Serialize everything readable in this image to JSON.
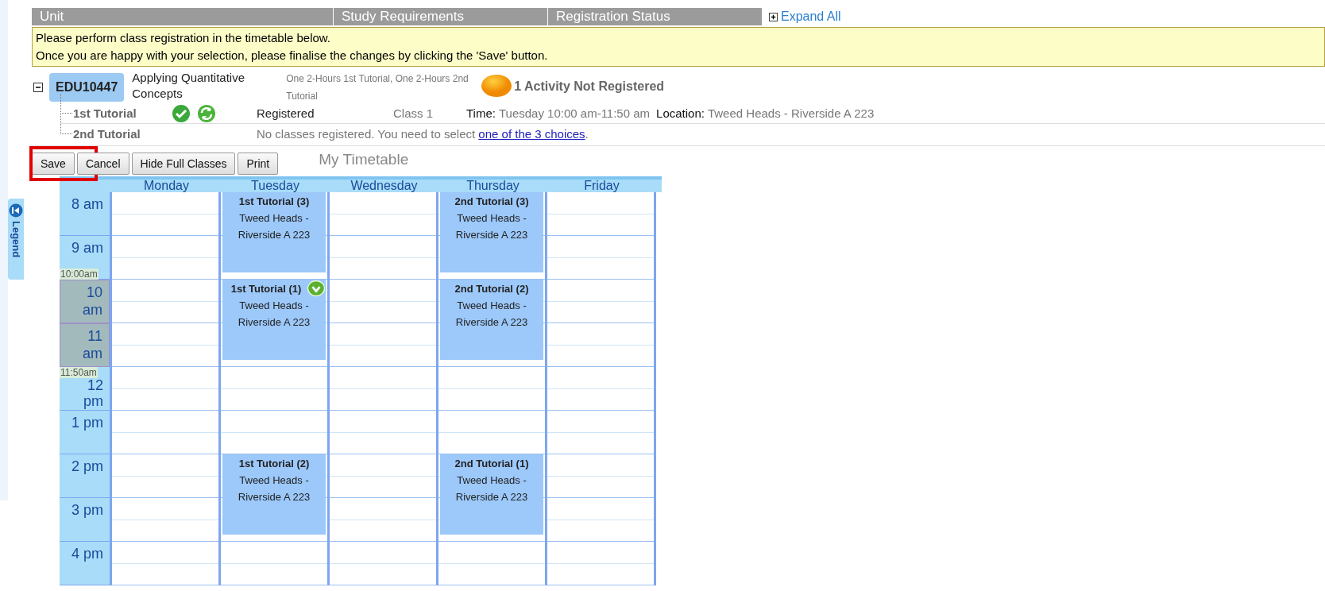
{
  "header": {
    "columns": [
      "Unit",
      "Study Requirements",
      "Registration Status"
    ],
    "expand_all": "Expand All"
  },
  "notice": [
    "Please perform class registration in the timetable below.",
    "Once you are happy with your selection, please finalise the changes by clicking the 'Save' button."
  ],
  "unit": {
    "code": "EDU10447",
    "title": "Applying Quantitative Concepts",
    "requirements": "One 2-Hours 1st Tutorial, One 2-Hours 2nd Tutorial",
    "status": "1 Activity Not Registered",
    "expanded": true,
    "activities": [
      {
        "kind": "registered",
        "name": "1st Tutorial",
        "status": "Registered",
        "class": "Class 1",
        "time_label": "Time:",
        "time": "Tuesday 10:00 am-11:50 am",
        "location_label": "Location:",
        "location": "Tweed Heads - Riverside A 223"
      },
      {
        "kind": "unregistered",
        "name": "2nd Tutorial",
        "message": "No classes registered. You need to select ",
        "link": "one of the 3 choices",
        "message_end": "."
      }
    ]
  },
  "toolbar": {
    "buttons": [
      {
        "label": "Save",
        "highlighted": true
      },
      {
        "label": "Cancel",
        "highlighted": false
      },
      {
        "label": "Hide Full Classes",
        "highlighted": false
      },
      {
        "label": "Print",
        "highlighted": false
      }
    ],
    "title": "My Timetable"
  },
  "legend": {
    "label": "Legend"
  },
  "timetable": {
    "days": [
      "Monday",
      "Tuesday",
      "Wednesday",
      "Thursday",
      "Friday"
    ],
    "selection": {
      "start_label": "10:00am",
      "end_label": "11:50am"
    },
    "rows": [
      {
        "hour": "8 am",
        "selected": false,
        "cells": [
          null,
          {
            "title": "1st Tutorial (3)",
            "location": "Tweed Heads - Riverside A 223",
            "registered": false
          },
          null,
          {
            "title": "2nd Tutorial (3)",
            "location": "Tweed Heads - Riverside A 223",
            "registered": false
          },
          null
        ]
      },
      {
        "hour": "9 am",
        "selected": false
      },
      {
        "hour": "10 am",
        "selected": true,
        "cells": [
          null,
          {
            "title": "1st Tutorial (1)",
            "location": "Tweed Heads - Riverside A 223",
            "registered": true
          },
          null,
          {
            "title": "2nd Tutorial (2)",
            "location": "Tweed Heads - Riverside A 223",
            "registered": false
          },
          null
        ]
      },
      {
        "hour": "11 am",
        "selected": true
      },
      {
        "hour": "12 pm",
        "selected": false
      },
      {
        "hour": "1 pm",
        "selected": false
      },
      {
        "hour": "2 pm",
        "selected": false,
        "cells": [
          null,
          {
            "title": "1st Tutorial (2)",
            "location": "Tweed Heads - Riverside A 223",
            "registered": false
          },
          null,
          {
            "title": "2nd Tutorial (1)",
            "location": "Tweed Heads - Riverside A 223",
            "registered": false
          },
          null
        ]
      },
      {
        "hour": "3 pm",
        "selected": false
      },
      {
        "hour": "4 pm",
        "selected": false
      }
    ]
  }
}
